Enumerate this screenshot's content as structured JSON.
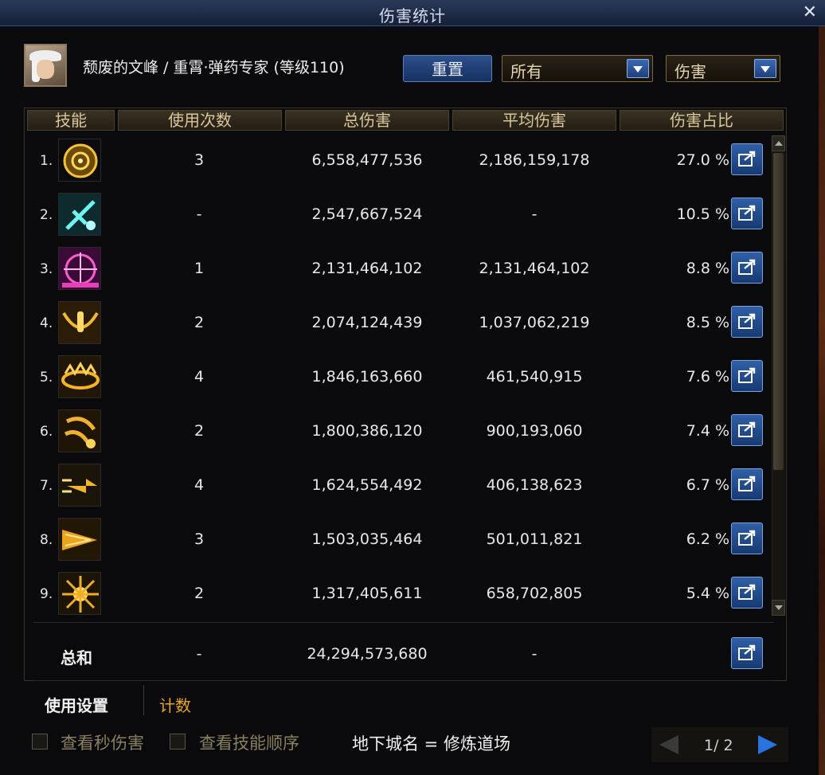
{
  "window": {
    "title": "伤害统计"
  },
  "header": {
    "character": "颓废的文峰 / 重霄·弹药专家 (等级110)",
    "reset_label": "重置",
    "filter1": "所有",
    "filter2": "伤害"
  },
  "columns": [
    "技能",
    "使用次数",
    "总伤害",
    "平均伤害",
    "伤害占比"
  ],
  "rows": [
    {
      "rank": "1.",
      "uses": "3",
      "total": "6,558,477,536",
      "avg": "2,186,159,178",
      "pct": "27.0 %",
      "icon": "crosshair-icon"
    },
    {
      "rank": "2.",
      "uses": "-",
      "total": "2,547,667,524",
      "avg": "-",
      "pct": "10.5 %",
      "icon": "turret-icon"
    },
    {
      "rank": "3.",
      "uses": "1",
      "total": "2,131,464,102",
      "avg": "2,131,464,102",
      "pct": "8.8 %",
      "icon": "target-icon"
    },
    {
      "rank": "4.",
      "uses": "2",
      "total": "2,074,124,439",
      "avg": "1,037,062,219",
      "pct": "8.5 %",
      "icon": "winged-shell-icon"
    },
    {
      "rank": "5.",
      "uses": "4",
      "total": "1,846,163,660",
      "avg": "461,540,915",
      "pct": "7.6 %",
      "icon": "burst-ring-icon"
    },
    {
      "rank": "6.",
      "uses": "2",
      "total": "1,800,386,120",
      "avg": "900,193,060",
      "pct": "7.4 %",
      "icon": "grenade-icon"
    },
    {
      "rank": "7.",
      "uses": "4",
      "total": "1,624,554,492",
      "avg": "406,138,623",
      "pct": "6.7 %",
      "icon": "bullet-icon"
    },
    {
      "rank": "8.",
      "uses": "3",
      "total": "1,503,035,464",
      "avg": "501,011,821",
      "pct": "6.2 %",
      "icon": "flame-shot-icon"
    },
    {
      "rank": "9.",
      "uses": "2",
      "total": "1,317,405,611",
      "avg": "658,702,805",
      "pct": "5.4 %",
      "icon": "explosion-icon"
    }
  ],
  "summary": {
    "label": "总和",
    "uses": "-",
    "total": "24,294,573,680",
    "avg": "-"
  },
  "tabs": {
    "tab1": "使用设置",
    "tab2": "计数"
  },
  "footer": {
    "check1": "查看秒伤害",
    "check2": "查看技能顺序",
    "dungeon": "地下城名 = 修炼道场",
    "page": "1/ 2"
  },
  "colors": {
    "accent_gold": "#e6a825",
    "header_gold": "#d9c79d",
    "button_blue": "#2f5fa8"
  }
}
